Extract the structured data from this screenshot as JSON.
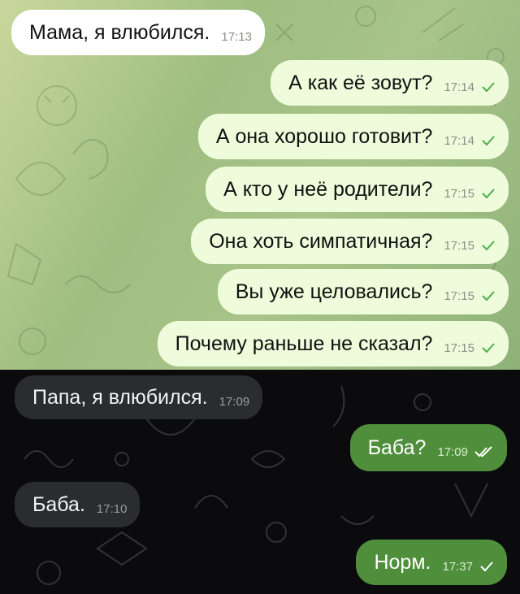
{
  "top_chat": {
    "messages": [
      {
        "direction": "in",
        "text": "Мама, я влюбился.",
        "time": "17:13",
        "status": ""
      },
      {
        "direction": "out",
        "text": "А как её зовут?",
        "time": "17:14",
        "status": "sent"
      },
      {
        "direction": "out",
        "text": "А она хорошо готовит?",
        "time": "17:14",
        "status": "sent"
      },
      {
        "direction": "out",
        "text": "А кто у неё родители?",
        "time": "17:15",
        "status": "sent"
      },
      {
        "direction": "out",
        "text": "Она хоть симпатичная?",
        "time": "17:15",
        "status": "sent"
      },
      {
        "direction": "out",
        "text": "Вы уже целовались?",
        "time": "17:15",
        "status": "sent"
      },
      {
        "direction": "out",
        "text": "Почему раньше не сказал?",
        "time": "17:15",
        "status": "sent"
      }
    ]
  },
  "bottom_chat": {
    "messages": [
      {
        "direction": "in",
        "text": "Папа, я влюбился.",
        "time": "17:09",
        "status": ""
      },
      {
        "direction": "out",
        "text": "Баба?",
        "time": "17:09",
        "status": "read"
      },
      {
        "direction": "in",
        "text": "Баба.",
        "time": "17:10",
        "status": ""
      },
      {
        "direction": "out",
        "text": "Норм.",
        "time": "17:37",
        "status": "sent"
      }
    ]
  },
  "colors": {
    "light_outgoing_bubble": "#eefcdb",
    "light_incoming_bubble": "#ffffff",
    "dark_incoming_bubble": "#2b2c30",
    "dark_outgoing_bubble": "#4f8f3c",
    "light_check": "#4caf50"
  }
}
